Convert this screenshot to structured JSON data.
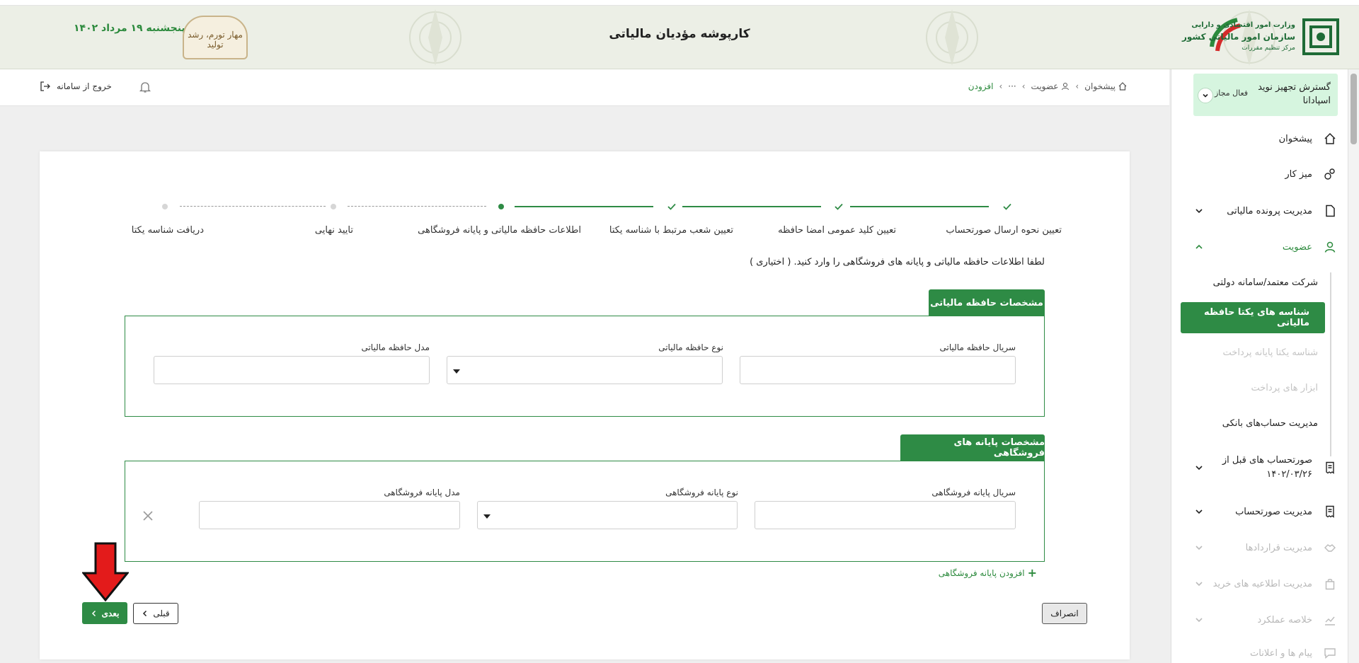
{
  "banner": {
    "title": "کارپوشه مؤدیان مالیاتی",
    "date": "پنجشنبه ۱۹ مرداد ۱۴۰۲",
    "seal_text": "مهار تورم، رشد تولید",
    "org_line1": "وزارت امور اقتصادی و دارایی",
    "org_line2": "سازمان امور مالیاتی کشور",
    "org_line3": "مرکز تنظیم مقررات"
  },
  "header": {
    "breadcrumb": [
      "پیشخوان",
      "عضویت",
      "···",
      "افزودن"
    ],
    "logout_label": "خروج از سامانه"
  },
  "sidebar": {
    "company": {
      "name": "گسترش تجهیز نوید اسپادانا",
      "status": "فعال مجاز"
    },
    "items": [
      {
        "label": "پیشخوان",
        "icon": "home-icon",
        "state": "normal"
      },
      {
        "label": "میز کار",
        "icon": "shapes-icon",
        "state": "normal"
      },
      {
        "label": "مدیریت پرونده مالیاتی",
        "icon": "file-icon",
        "state": "normal"
      },
      {
        "label": "عضویت",
        "icon": "user-icon",
        "state": "expanded"
      },
      {
        "label": "صورتحساب های قبل از ۱۴۰۲/۰۳/۲۶",
        "icon": "receipt-icon",
        "state": "normal"
      },
      {
        "label": "مدیریت صورتحساب",
        "icon": "receipt-icon",
        "state": "normal"
      },
      {
        "label": "مدیریت قراردادها",
        "icon": "handshake-icon",
        "state": "disabled"
      },
      {
        "label": "مدیریت اطلاعیه های خرید",
        "icon": "bag-icon",
        "state": "disabled"
      },
      {
        "label": "خلاصه عملکرد",
        "icon": "chart-icon",
        "state": "disabled"
      },
      {
        "label": "پیام ها و اعلانات",
        "icon": "message-icon",
        "state": "disabled"
      }
    ],
    "subitems": [
      {
        "label": "شرکت معتمد/سامانه دولتی",
        "state": "normal"
      },
      {
        "label": "شناسه های یکتا حافظه مالیاتی",
        "state": "active"
      },
      {
        "label": "شناسه یکتا پایانه پرداخت",
        "state": "disabled"
      },
      {
        "label": "ابزار های پرداخت",
        "state": "disabled"
      },
      {
        "label": "مدیریت حساب‌های بانکی",
        "state": "normal"
      }
    ]
  },
  "stepper": {
    "steps": [
      {
        "label": "تعیین نحوه ارسال صورتحساب",
        "state": "done"
      },
      {
        "label": "تعیین کلید عمومی امضا حافظه",
        "state": "done"
      },
      {
        "label": "تعیین شعب مرتبط با شناسه یکتا",
        "state": "done"
      },
      {
        "label": "اطلاعات حافظه مالیاتی و پایانه فروشگاهی",
        "state": "current"
      },
      {
        "label": "تایید نهایی",
        "state": "todo"
      },
      {
        "label": "دریافت شناسه یکتا",
        "state": "todo"
      }
    ]
  },
  "form": {
    "instruction": "لطفا اطلاعات حافظه مالیاتی و پایانه های فروشگاهی را وارد کنید. ( اختیاری )",
    "memory_section": {
      "title": "مشخصات حافظه مالیاتی",
      "serial_label": "سریال حافظه مالیاتی",
      "type_label": "نوع حافظه مالیاتی",
      "model_label": "مدل حافظه مالیاتی",
      "serial_value": "",
      "type_value": "",
      "model_value": ""
    },
    "terminal_section": {
      "title": "مشخصات پایانه های فروشگاهی",
      "serial_label": "سریال پایانه فروشگاهی",
      "type_label": "نوع پایانه فروشگاهی",
      "model_label": "مدل پایانه فروشگاهی",
      "serial_value": "",
      "type_value": "",
      "model_value": ""
    },
    "add_terminal_label": "افزودن پایانه فروشگاهی"
  },
  "actions": {
    "cancel_label": "انصراف",
    "prev_label": "قبلی",
    "next_label": "بعدی"
  },
  "colors": {
    "primary_green": "#2e8b45",
    "banner_bg": "#ecefe6",
    "company_card_bg": "#d6f5df",
    "annotation_arrow": "#e31b1b"
  }
}
